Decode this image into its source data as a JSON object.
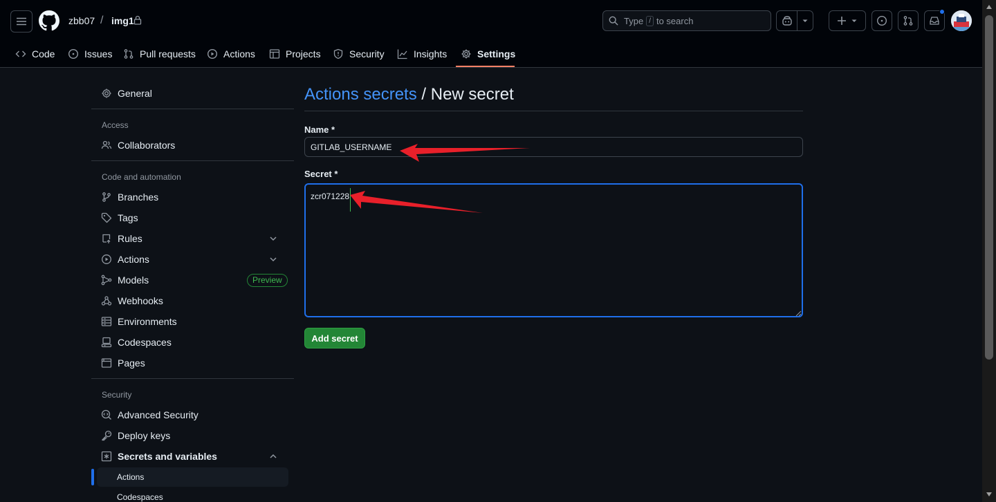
{
  "header": {
    "owner": "zbb07",
    "separator": "/",
    "repo": "img1",
    "search_before": "Type",
    "search_key": "/",
    "search_after": "to search"
  },
  "nav": {
    "items": [
      {
        "label": "Code",
        "icon": "code-icon"
      },
      {
        "label": "Issues",
        "icon": "issue-opened-icon"
      },
      {
        "label": "Pull requests",
        "icon": "git-pull-request-icon"
      },
      {
        "label": "Actions",
        "icon": "play-icon"
      },
      {
        "label": "Projects",
        "icon": "table-icon"
      },
      {
        "label": "Security",
        "icon": "shield-icon"
      },
      {
        "label": "Insights",
        "icon": "graph-icon"
      },
      {
        "label": "Settings",
        "icon": "gear-icon",
        "active": true
      }
    ]
  },
  "sidebar": {
    "general": "General",
    "access_heading": "Access",
    "collaborators": "Collaborators",
    "code_heading": "Code and automation",
    "branches": "Branches",
    "tags": "Tags",
    "rules": "Rules",
    "actions": "Actions",
    "models": "Models",
    "preview_badge": "Preview",
    "webhooks": "Webhooks",
    "environments": "Environments",
    "codespaces": "Codespaces",
    "pages": "Pages",
    "security_heading": "Security",
    "advanced_security": "Advanced Security",
    "deploy_keys": "Deploy keys",
    "secrets_and_variables": "Secrets and variables",
    "sub_actions": "Actions",
    "sub_codespaces": "Codespaces"
  },
  "main": {
    "title_link": "Actions secrets",
    "title_sep": " / ",
    "title_rest": "New secret",
    "name_label": "Name *",
    "name_value": "GITLAB_USERNAME",
    "secret_label": "Secret *",
    "secret_value": "zcr071228",
    "submit_label": "Add secret"
  },
  "colors": {
    "accent_link": "#4493f8",
    "primary_button": "#238636",
    "annotation_arrow": "#e8202a",
    "focus_border": "#1f6feb"
  }
}
